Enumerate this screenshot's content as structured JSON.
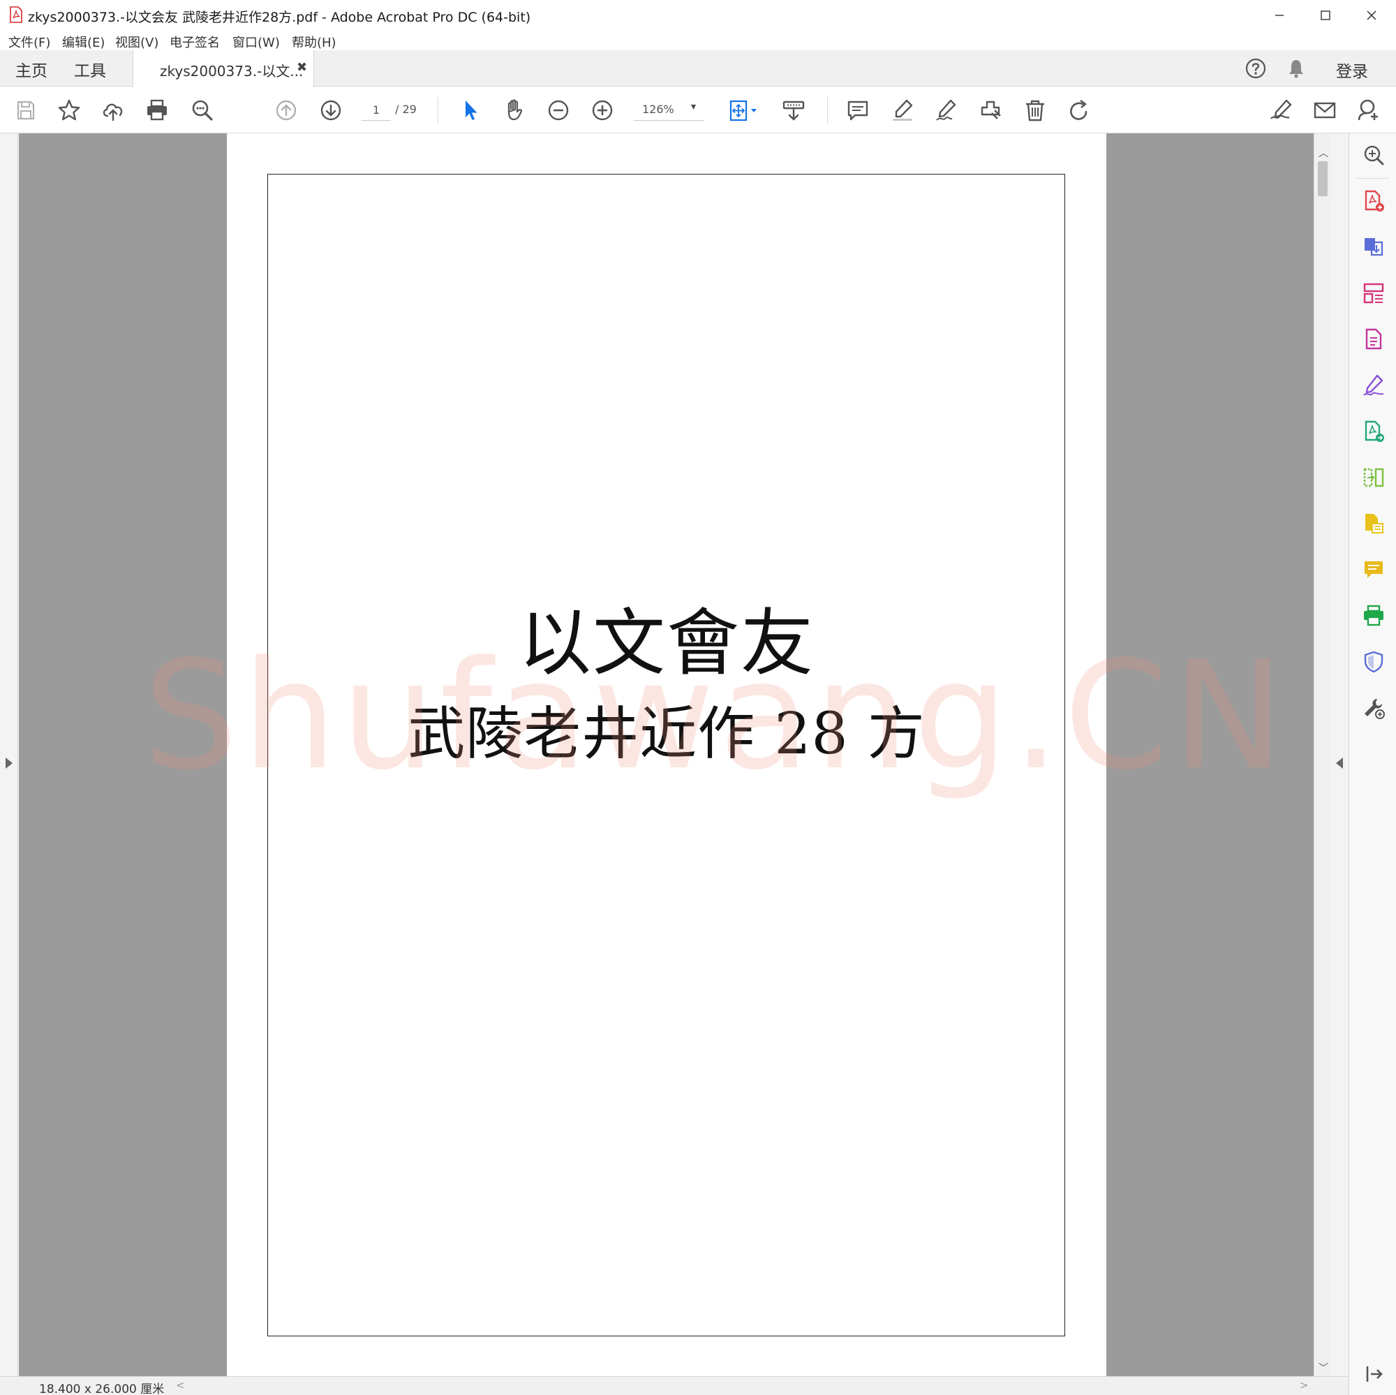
{
  "window": {
    "title": "zkys2000373.-以文会友 武陵老井近作28方.pdf - Adobe Acrobat Pro DC (64-bit)",
    "app_icon": "pdf-file-icon",
    "controls": [
      "minimize-icon",
      "maximize-icon",
      "close-icon"
    ]
  },
  "menu": {
    "items": [
      "文件(F)",
      "编辑(E)",
      "视图(V)",
      "电子签名",
      "窗口(W)",
      "帮助(H)"
    ]
  },
  "tabs": {
    "home": "主页",
    "tools": "工具",
    "document": "zkys2000373.-以文...",
    "close_glyph": "✖",
    "login": "登录"
  },
  "toolbar": {
    "current_page": "1",
    "total_pages": "/ 29",
    "zoom": "126%",
    "zoom_caret": "▾",
    "tools": [
      "save-icon",
      "bookmark-star-icon",
      "cloud-upload-icon",
      "print-icon",
      "find-zoom-icon",
      "previous-page-icon",
      "next-page-icon",
      "select-cursor-icon",
      "hand-icon",
      "zoom-out-icon",
      "zoom-in-icon",
      "fit-page-icon",
      "scroll-mode-icon",
      "comment-icon",
      "highlight-icon",
      "sign-icon",
      "stamp-icon",
      "delete-icon",
      "rotate-icon",
      "fill-sign-icon",
      "email-icon",
      "share-user-icon"
    ]
  },
  "document": {
    "title_line": "以文會友",
    "subtitle_line": "武陵老井近作 28 方",
    "watermark": "Shufawang.CN"
  },
  "right_pane": {
    "tools": [
      "enhance-scan-icon",
      "create-pdf-icon",
      "export-pdf-icon",
      "organize-pages-icon",
      "edit-pdf-icon",
      "fill-sign-pane-icon",
      "send-for-review-icon",
      "compare-icon",
      "export-file-icon",
      "comment-pane-icon",
      "print-production-icon",
      "protect-icon",
      "more-tools-icon",
      "collapse-pane-icon"
    ]
  },
  "status": {
    "page_size": "18.400 x 26.000 厘米"
  },
  "colors": {
    "acrobat_red": "#d6282e",
    "toolbar_blue": "#1473e6",
    "viewer_gray": "#9b9b9b",
    "watermark": "#ee8c78"
  }
}
